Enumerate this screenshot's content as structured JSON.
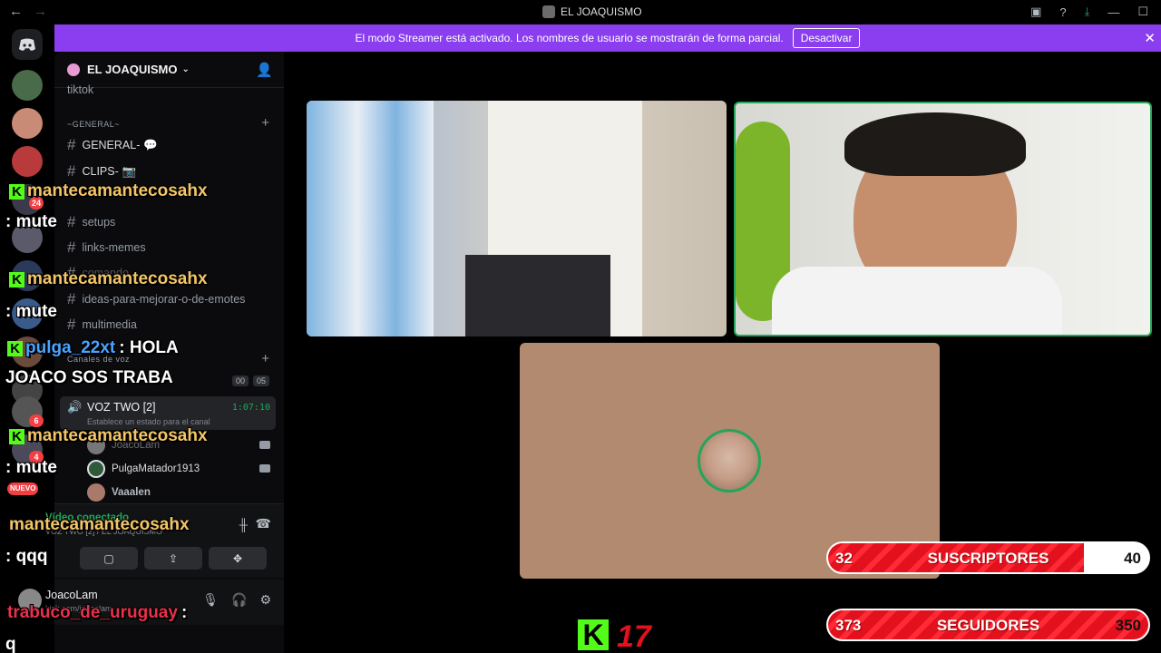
{
  "titlebar": {
    "title": "EL JOAQUISMO",
    "back": "←",
    "forward": "→"
  },
  "banner": {
    "text": "El modo Streamer está activado. Los nombres de usuario se mostrarán de forma parcial.",
    "button": "Desactivar",
    "close": "✕"
  },
  "sidebar": {
    "server_name": "EL JOAQUISMO",
    "partial_top": "tiktok",
    "category_general": "~GENERAL~",
    "channels": [
      "GENERAL-",
      "CLIPS-",
      "setups",
      "links-memes",
      "comando",
      "ideas-para-mejorar-o-de-emotes",
      "multimedia"
    ],
    "category_voice": "Canales de voz",
    "voice_counts": [
      "00",
      "05"
    ],
    "voice_channel": {
      "name": "VOZ TWO [2]",
      "time": "1:07:10",
      "status": "Establece un estado para el canal"
    },
    "voice_users": [
      "JoacoLam",
      "PulgaMatador1913",
      "Vaaalen"
    ]
  },
  "voice_panel": {
    "status": "Vídeo conectado",
    "sub": "VOZ TWO [2] / EL JOAQUISMO"
  },
  "user_panel": {
    "username": "JoacoLam",
    "status": "kick.com/joacolam"
  },
  "rail": {
    "badges": [
      "24",
      "6",
      "4",
      "NUEVO"
    ]
  },
  "chat_overlay": [
    {
      "user": "mantecamantecosahx",
      "msg": ": mute"
    },
    {
      "user": "mantecamantecosahx",
      "msg": ": mute"
    },
    {
      "user": "pulga_22xt",
      "msg": ": HOLA"
    },
    {
      "line": "JOACO SOS TRABA"
    },
    {
      "user": "mantecamantecosahx",
      "msg": ": mute"
    },
    {
      "user": "mantecamantecosahx",
      "msg": ": qqq"
    },
    {
      "user": "trabuco_de_uruguay",
      "msg": ":"
    },
    {
      "line": "q"
    }
  ],
  "stats": [
    {
      "label": "SUSCRIPTORES",
      "current": "32",
      "goal": "40",
      "progress": 0.8
    },
    {
      "label": "SEGUIDORES",
      "current": "373",
      "goal": "350",
      "progress": 1.0
    }
  ],
  "brand": {
    "kick_letter": "K",
    "number": "17"
  },
  "colors": {
    "accent": "#8a3ef0",
    "online": "#23a55a",
    "kick": "#53fc18",
    "stat_red": "#e3101d"
  }
}
